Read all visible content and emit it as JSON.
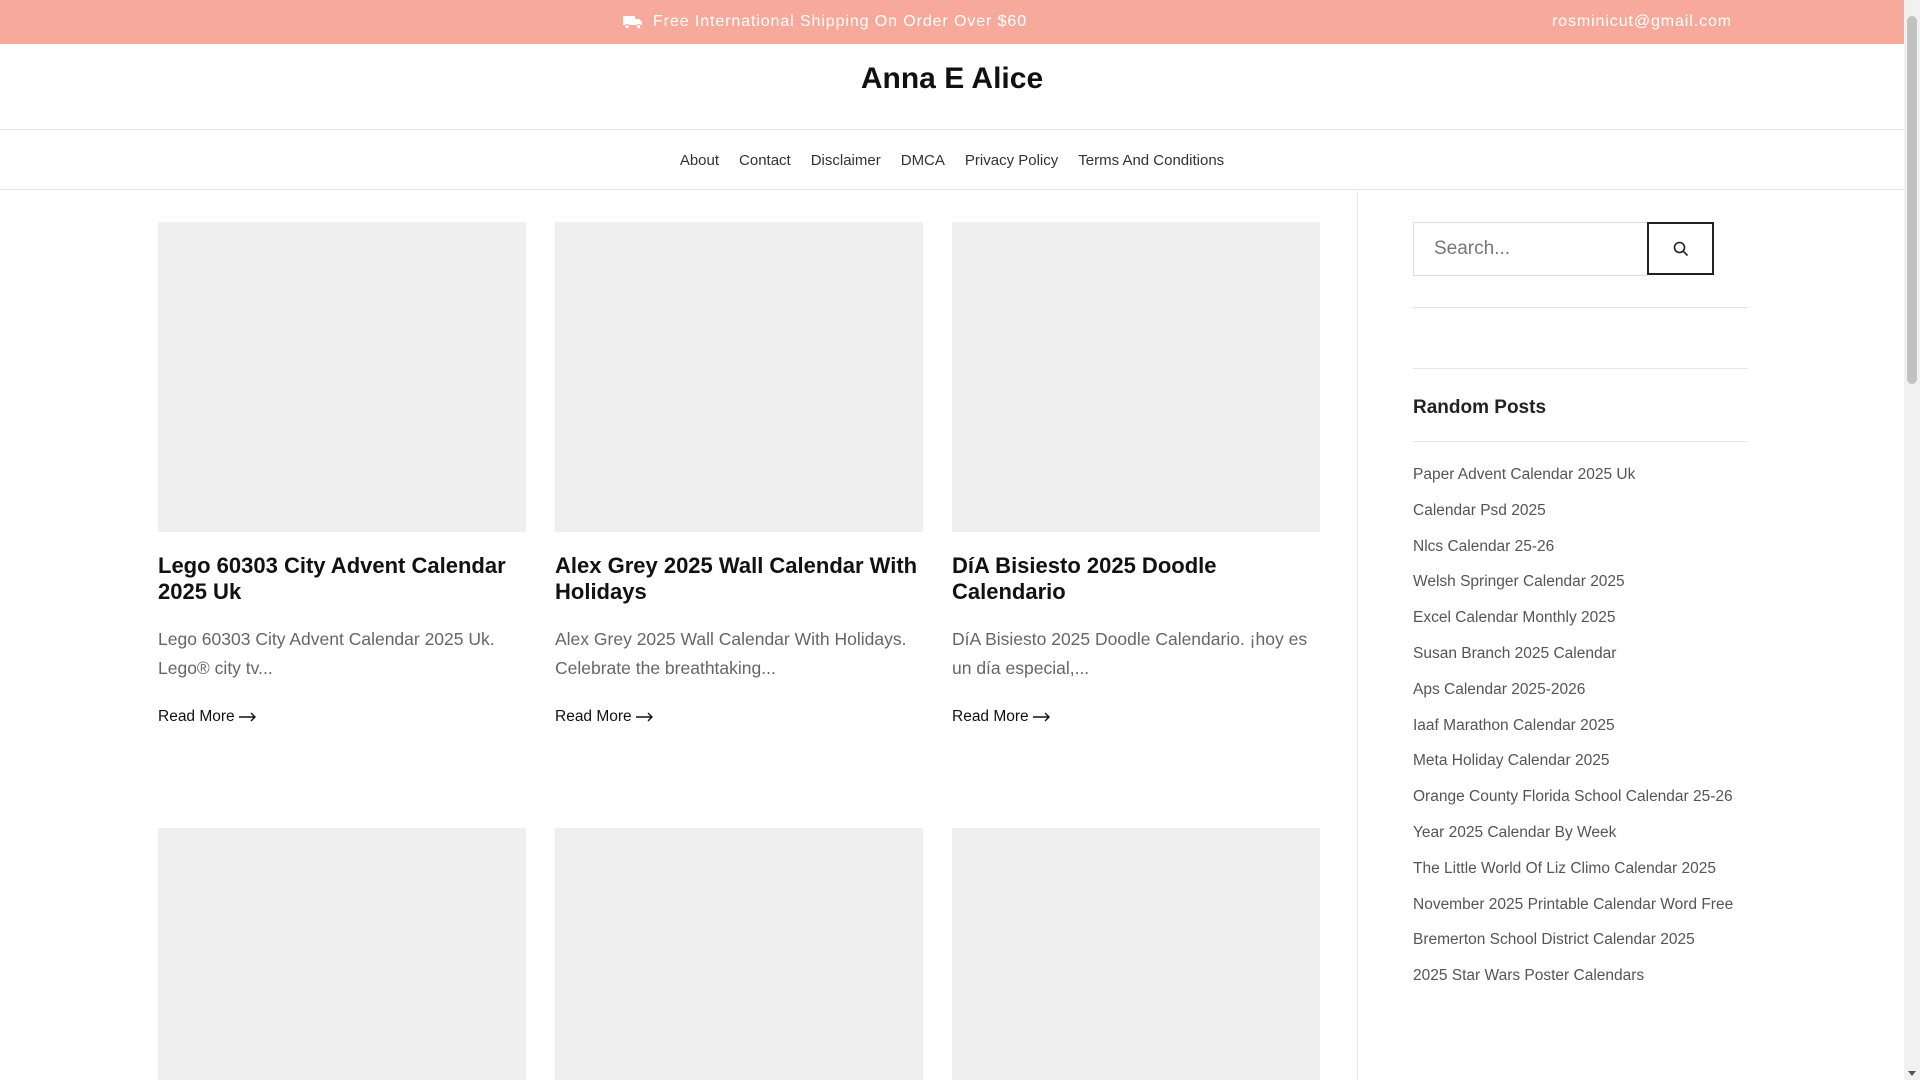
{
  "topbar": {
    "shipping_text": "Free International Shipping On Order Over $60",
    "shipping_icon": "truck-icon",
    "email": "rosminicut@gmail.com",
    "bg_color": "#f7aa9b"
  },
  "site": {
    "title": "Anna E Alice"
  },
  "nav": {
    "items": [
      {
        "label": "About"
      },
      {
        "label": "Contact"
      },
      {
        "label": "Disclaimer"
      },
      {
        "label": "DMCA"
      },
      {
        "label": "Privacy Policy"
      },
      {
        "label": "Terms And Conditions"
      }
    ]
  },
  "posts": [
    {
      "title": "Lego 60303 City Advent Calendar 2025 Uk",
      "excerpt": "Lego 60303 City Advent Calendar 2025 Uk. Lego® city tv...",
      "read_more": "Read More"
    },
    {
      "title": "Alex Grey 2025 Wall Calendar With Holidays",
      "excerpt": "Alex Grey 2025 Wall Calendar With Holidays. Celebrate the breathtaking...",
      "read_more": "Read More"
    },
    {
      "title": "DíA Bisiesto 2025 Doodle Calendario",
      "excerpt": "DíA Bisiesto 2025 Doodle Calendario. ¡hoy es un día especial,...",
      "read_more": "Read More"
    }
  ],
  "sidebar": {
    "search": {
      "placeholder": "Search...",
      "value": "",
      "icon": "search-icon"
    },
    "random_posts": {
      "title": "Random Posts",
      "items": [
        "Paper Advent Calendar 2025 Uk",
        "Calendar Psd 2025",
        "Nlcs Calendar 25-26",
        "Welsh Springer Calendar 2025",
        "Excel Calendar Monthly 2025",
        "Susan Branch 2025 Calendar",
        "Aps Calendar 2025-2026",
        "Iaaf Marathon Calendar 2025",
        "Meta Holiday Calendar 2025",
        "Orange County Florida School Calendar 25-26",
        "Year 2025 Calendar By Week",
        "The Little World Of Liz Climo Calendar 2025",
        "November 2025 Printable Calendar Word Free",
        "Bremerton School District Calendar 2025",
        "2025 Star Wars Poster Calendars"
      ]
    }
  }
}
